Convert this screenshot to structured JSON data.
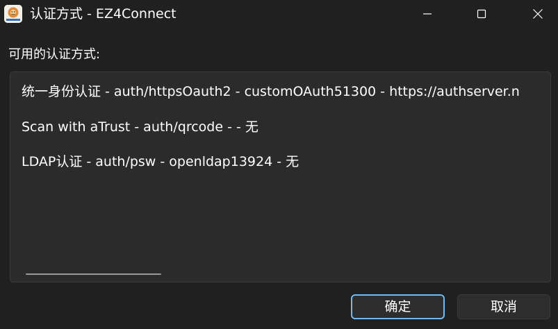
{
  "window": {
    "title": "认证方式 - EZ4Connect",
    "icon": "app-logo-icon",
    "controls": [
      "minimize-icon",
      "maximize-icon",
      "close-icon"
    ]
  },
  "dialog": {
    "prompt": "可用的认证方式:",
    "methods": [
      "统一身份认证 - auth/httpsOauth2 - customOAuth51300 - https://authserver.n",
      "Scan with aTrust - auth/qrcode -  - 无",
      "LDAP认证 - auth/psw - openldap13924 - 无"
    ],
    "ok_label": "确定",
    "cancel_label": "取消"
  },
  "colors": {
    "background": "#202020",
    "list_background": "#2b2b2b",
    "accent_border": "#76b9ed"
  }
}
